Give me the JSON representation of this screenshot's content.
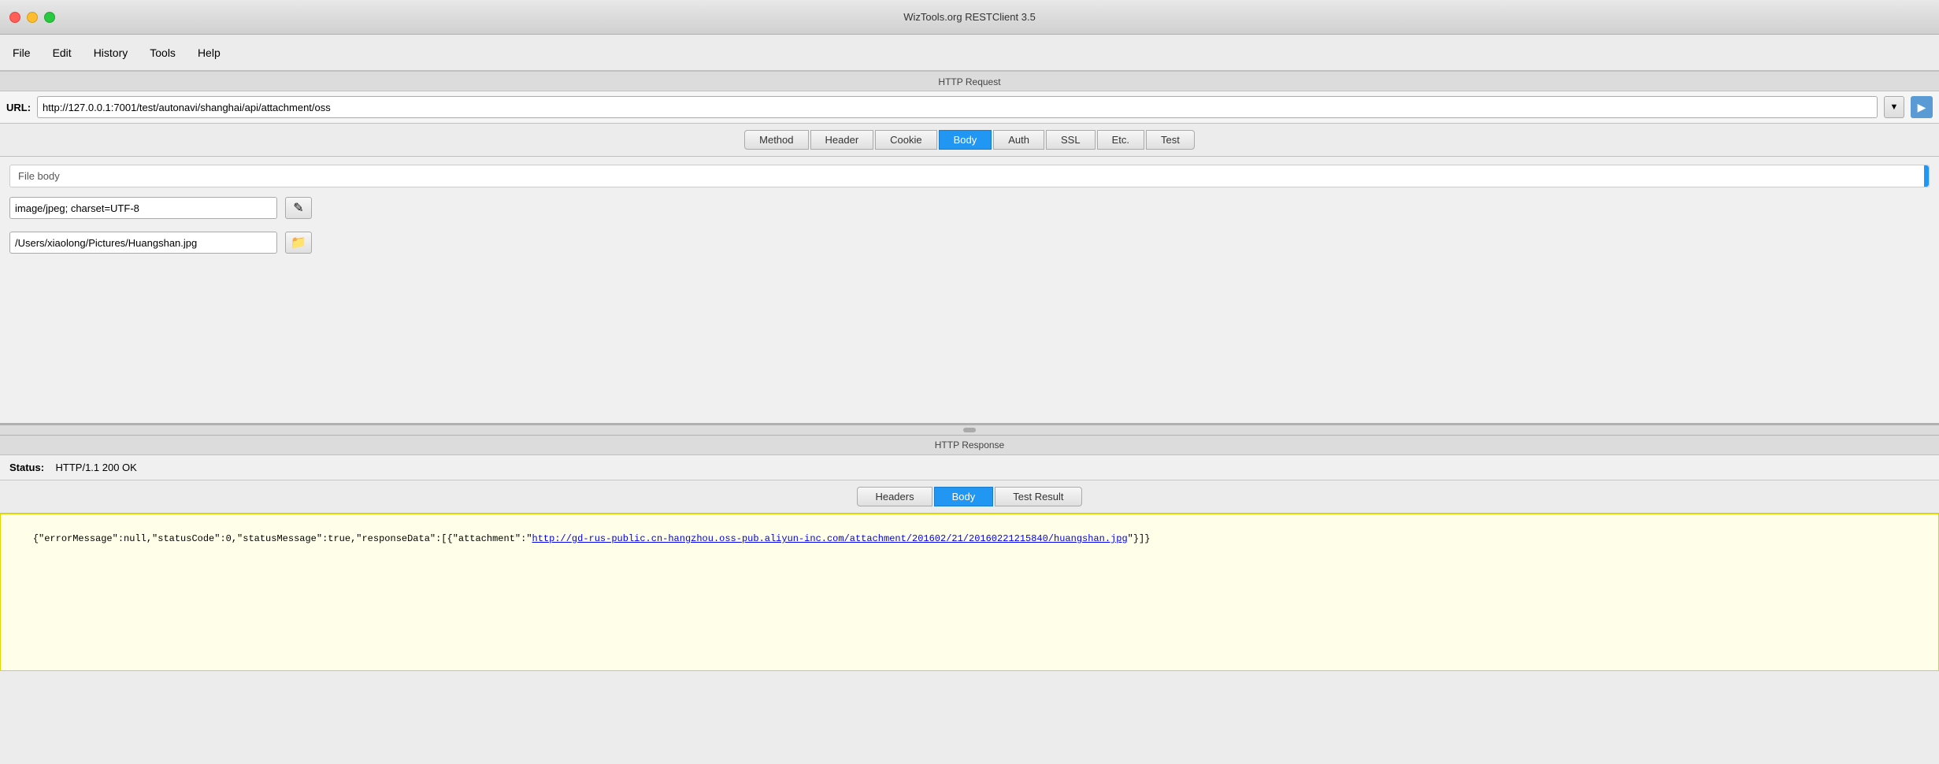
{
  "app": {
    "title": "WizTools.org RESTClient 3.5"
  },
  "menu": {
    "items": [
      "File",
      "Edit",
      "History",
      "Tools",
      "Help"
    ]
  },
  "request": {
    "section_label": "HTTP Request",
    "url_label": "URL:",
    "url_value": "http://127.0.0.1:7001/test/autonavi/shanghai/api/attachment/oss",
    "tabs": [
      "Method",
      "Header",
      "Cookie",
      "Body",
      "Auth",
      "SSL",
      "Etc.",
      "Test"
    ],
    "active_tab": "Body",
    "file_body_label": "File body",
    "content_type_value": "image/jpeg; charset=UTF-8",
    "file_path_value": "/Users/xiaolong/Pictures/Huangshan.jpg",
    "edit_icon": "✎",
    "folder_icon": "📁"
  },
  "response": {
    "section_label": "HTTP Response",
    "status_label": "Status:",
    "status_value": "HTTP/1.1 200 OK",
    "tabs": [
      "Headers",
      "Body",
      "Test Result"
    ],
    "active_tab": "Body",
    "body_prefix": "{\"errorMessage\":null,\"statusCode\":0,\"statusMessage\":true,\"responseData\":[{\"attachment\":\"",
    "body_link": "http://gd-rus-public.cn-hangzhou.oss-pub.aliyun-inc.com/attachment/201602/21/20160221215840/huangshan.jpg",
    "body_suffix": "\"}]}"
  },
  "icons": {
    "dropdown_arrow": "▼",
    "divider_handle": "•••"
  }
}
